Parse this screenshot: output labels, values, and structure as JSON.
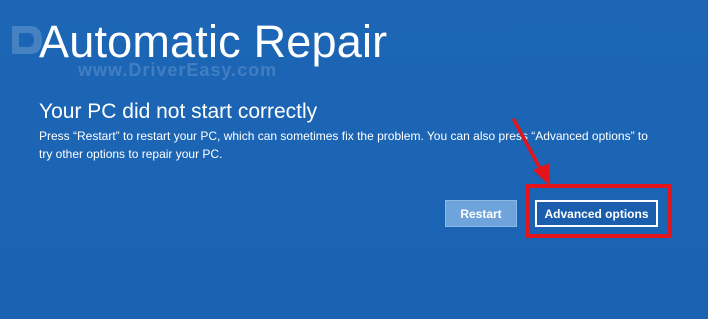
{
  "window": {
    "title": "Automatic Repair",
    "subtitle": "Your PC did not start correctly",
    "message": "Press “Restart” to restart your PC, which can sometimes fix the problem. You can also press “Advanced options” to try other options to repair your PC."
  },
  "watermark": {
    "text": "www.DriverEasy.com"
  },
  "buttons": {
    "restart_label": "Restart",
    "advanced_label": "Advanced options"
  },
  "colors": {
    "background": "#1a64b4",
    "highlight": "#e4141b",
    "restart_button": "#6fa3dc"
  },
  "icons": {
    "watermark_logo": "drivereasy-logo",
    "annotation_arrow": "red-arrow"
  }
}
